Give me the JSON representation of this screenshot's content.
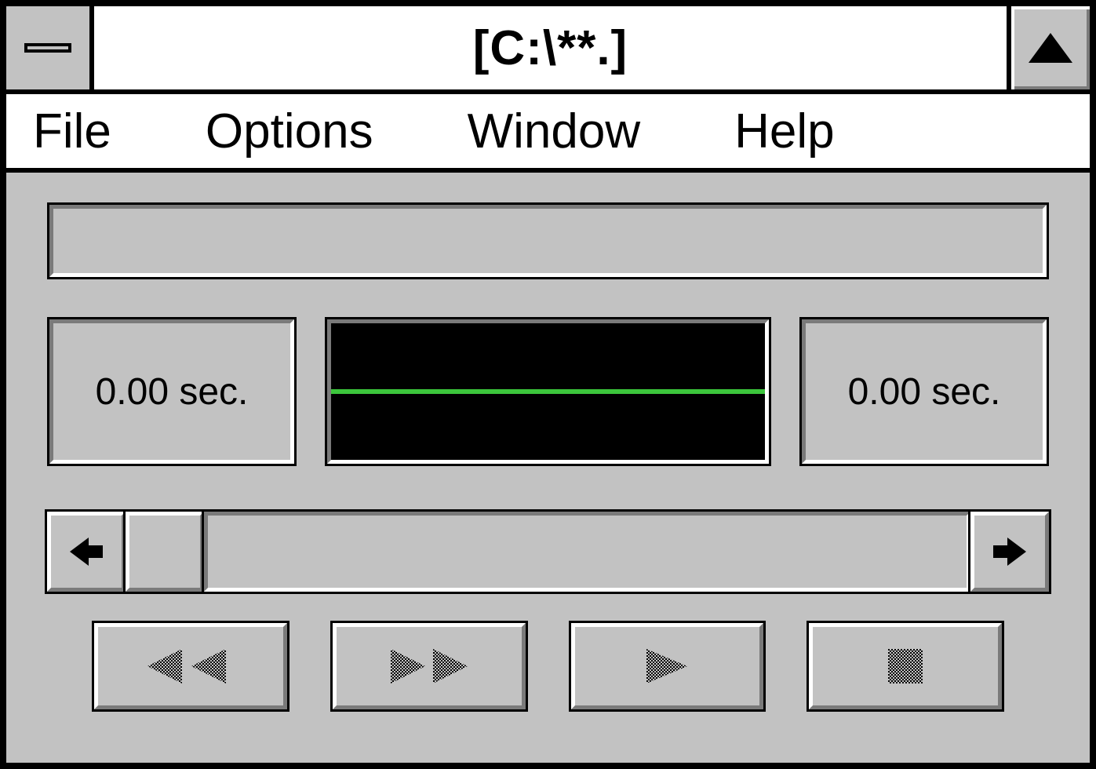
{
  "titlebar": {
    "title": "[C:\\**.]"
  },
  "menu": {
    "file": "File",
    "options": "Options",
    "window": "Window",
    "help": "Help"
  },
  "playback": {
    "position": "0.00 sec.",
    "length": "0.00 sec."
  }
}
